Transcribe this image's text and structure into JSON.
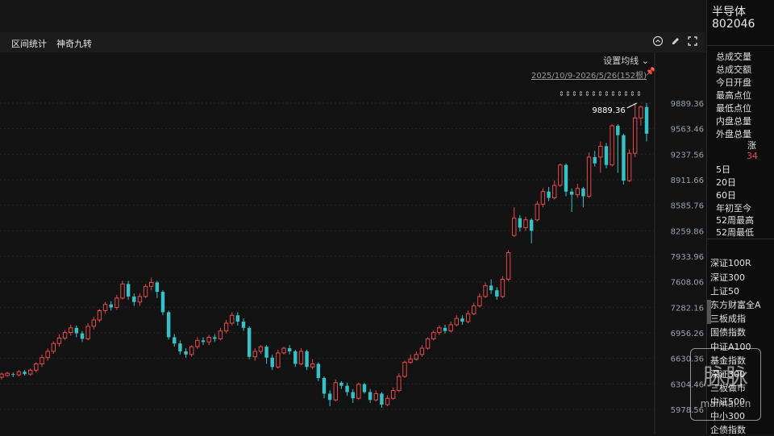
{
  "toolbar": {
    "interval_stats": "区间统计",
    "magic_nine": "神奇九转"
  },
  "chart_header": {
    "ma_setting": "设置均线",
    "range": "2025/10/9-2026/5/26(152根)"
  },
  "security": {
    "name": "半导体",
    "code": "802046"
  },
  "stats_labels": [
    "总成交量",
    "总成交额",
    "今日开盘",
    "最高点位",
    "最低点位",
    "内盘总量",
    "外盘总量"
  ],
  "change": {
    "label": "涨",
    "value": "34"
  },
  "periods": [
    "5日",
    "20日",
    "60日",
    "年初至今",
    "52周最高",
    "52周最低"
  ],
  "indices": [
    "深证100R",
    "深证300",
    "上证50",
    "东方财富全A",
    "三板成指",
    "国债指数",
    "中证A100",
    "基金指数",
    "深证300",
    "三板做市",
    "中证500",
    "中小300",
    "企债指数"
  ],
  "watermark": {
    "text": "脉脉",
    "sub": "maimai.cn"
  },
  "colors": {
    "up": "#e8474b",
    "down": "#35c2c6",
    "axis": "#9aa0a6",
    "grid": "#262626"
  },
  "chart_data": {
    "type": "candlestick",
    "y_ticks": [
      "9889.36",
      "9563.46",
      "9237.56",
      "8911.66",
      "8585.76",
      "8259.86",
      "7933.96",
      "7608.06",
      "7282.16",
      "6956.26",
      "6630.36",
      "6304.46",
      "5978.56"
    ],
    "y_range": [
      5900,
      10010
    ],
    "highest_label": "9889.36",
    "candles": [
      [
        6390,
        6430,
        6360,
        6450
      ],
      [
        6410,
        6440,
        6400,
        6460
      ],
      [
        6430,
        6420,
        6390,
        6450
      ],
      [
        6420,
        6460,
        6400,
        6480
      ],
      [
        6460,
        6430,
        6410,
        6480
      ],
      [
        6430,
        6480,
        6410,
        6500
      ],
      [
        6480,
        6560,
        6450,
        6580
      ],
      [
        6560,
        6640,
        6520,
        6680
      ],
      [
        6640,
        6720,
        6600,
        6760
      ],
      [
        6720,
        6820,
        6690,
        6850
      ],
      [
        6820,
        6890,
        6780,
        6940
      ],
      [
        6890,
        6960,
        6860,
        6990
      ],
      [
        6960,
        7020,
        6920,
        7060
      ],
      [
        7020,
        6950,
        6900,
        7050
      ],
      [
        6950,
        6880,
        6840,
        6980
      ],
      [
        6880,
        7040,
        6860,
        7080
      ],
      [
        7040,
        7120,
        7000,
        7160
      ],
      [
        7120,
        7240,
        7090,
        7260
      ],
      [
        7240,
        7320,
        7200,
        7350
      ],
      [
        7320,
        7280,
        7240,
        7360
      ],
      [
        7280,
        7400,
        7250,
        7440
      ],
      [
        7400,
        7580,
        7380,
        7620
      ],
      [
        7580,
        7420,
        7380,
        7620
      ],
      [
        7420,
        7350,
        7300,
        7460
      ],
      [
        7350,
        7420,
        7300,
        7460
      ],
      [
        7420,
        7550,
        7400,
        7580
      ],
      [
        7550,
        7600,
        7500,
        7660
      ],
      [
        7600,
        7480,
        7400,
        7620
      ],
      [
        7480,
        7220,
        7180,
        7500
      ],
      [
        7220,
        6900,
        6870,
        7240
      ],
      [
        6900,
        6820,
        6780,
        6940
      ],
      [
        6820,
        6720,
        6680,
        6860
      ],
      [
        6720,
        6680,
        6640,
        6760
      ],
      [
        6680,
        6780,
        6650,
        6800
      ],
      [
        6780,
        6860,
        6750,
        6900
      ],
      [
        6860,
        6840,
        6800,
        6900
      ],
      [
        6840,
        6900,
        6800,
        6930
      ],
      [
        6900,
        6880,
        6840,
        6940
      ],
      [
        6880,
        6980,
        6860,
        7020
      ],
      [
        6980,
        7080,
        6950,
        7120
      ],
      [
        7080,
        7180,
        7050,
        7220
      ],
      [
        7180,
        7100,
        7050,
        7220
      ],
      [
        7100,
        7020,
        6980,
        7140
      ],
      [
        7020,
        6650,
        6620,
        7040
      ],
      [
        6650,
        6720,
        6600,
        6760
      ],
      [
        6720,
        6780,
        6690,
        6800
      ],
      [
        6780,
        6640,
        6560,
        6800
      ],
      [
        6640,
        6520,
        6480,
        6680
      ],
      [
        6520,
        6700,
        6500,
        6740
      ],
      [
        6700,
        6760,
        6680,
        6780
      ],
      [
        6760,
        6720,
        6680,
        6800
      ],
      [
        6720,
        6560,
        6520,
        6740
      ],
      [
        6560,
        6720,
        6540,
        6760
      ],
      [
        6720,
        6520,
        6480,
        6740
      ],
      [
        6520,
        6560,
        6490,
        6620
      ],
      [
        6560,
        6380,
        6340,
        6580
      ],
      [
        6380,
        6180,
        6120,
        6400
      ],
      [
        6180,
        6100,
        6020,
        6220
      ],
      [
        6100,
        6320,
        6080,
        6360
      ],
      [
        6320,
        6280,
        6240,
        6340
      ],
      [
        6280,
        6200,
        6150,
        6320
      ],
      [
        6200,
        6120,
        6060,
        6240
      ],
      [
        6120,
        6300,
        6100,
        6320
      ],
      [
        6300,
        6200,
        6180,
        6320
      ],
      [
        6200,
        6100,
        6060,
        6240
      ],
      [
        6100,
        6180,
        6080,
        6220
      ],
      [
        6180,
        6040,
        6000,
        6200
      ],
      [
        6040,
        6120,
        6020,
        6160
      ],
      [
        6120,
        6220,
        6100,
        6260
      ],
      [
        6220,
        6400,
        6200,
        6440
      ],
      [
        6400,
        6580,
        6380,
        6600
      ],
      [
        6580,
        6620,
        6560,
        6680
      ],
      [
        6620,
        6680,
        6600,
        6720
      ],
      [
        6680,
        6760,
        6650,
        6800
      ],
      [
        6760,
        6880,
        6740,
        6900
      ],
      [
        6880,
        6960,
        6860,
        6990
      ],
      [
        6960,
        7020,
        6930,
        7050
      ],
      [
        7020,
        6980,
        6950,
        7060
      ],
      [
        6980,
        7060,
        6960,
        7100
      ],
      [
        7060,
        7140,
        7040,
        7180
      ],
      [
        7140,
        7100,
        7060,
        7180
      ],
      [
        7100,
        7200,
        7080,
        7240
      ],
      [
        7200,
        7300,
        7180,
        7340
      ],
      [
        7300,
        7420,
        7280,
        7460
      ],
      [
        7420,
        7560,
        7400,
        7600
      ],
      [
        7560,
        7500,
        7450,
        7640
      ],
      [
        7500,
        7420,
        7380,
        7540
      ],
      [
        7420,
        7640,
        7400,
        7680
      ],
      [
        7640,
        7980,
        7620,
        8010
      ],
      [
        8200,
        8420,
        8180,
        8560
      ],
      [
        8420,
        8300,
        8250,
        8460
      ],
      [
        8300,
        8400,
        8260,
        8440
      ],
      [
        8400,
        8260,
        8100,
        8420
      ],
      [
        8400,
        8600,
        8380,
        8640
      ],
      [
        8600,
        8760,
        8560,
        8800
      ],
      [
        8760,
        8680,
        8640,
        8820
      ],
      [
        8680,
        8840,
        8660,
        8900
      ],
      [
        8840,
        9100,
        8820,
        9120
      ],
      [
        9100,
        8760,
        8700,
        9120
      ],
      [
        8760,
        8720,
        8500,
        8800
      ],
      [
        8720,
        8800,
        8680,
        8860
      ],
      [
        8800,
        8700,
        8560,
        8820
      ],
      [
        8700,
        9200,
        8680,
        9260
      ],
      [
        9200,
        9120,
        9080,
        9280
      ],
      [
        9200,
        9340,
        9000,
        9400
      ],
      [
        9340,
        9100,
        9060,
        9380
      ],
      [
        9100,
        9600,
        9080,
        9620
      ],
      [
        9600,
        9480,
        9000,
        9620
      ],
      [
        9480,
        8900,
        8850,
        9500
      ],
      [
        8900,
        9250,
        8880,
        9300
      ],
      [
        9250,
        9700,
        9200,
        9880
      ],
      [
        9700,
        9840,
        9600,
        9860
      ],
      [
        9840,
        9500,
        9400,
        9889
      ]
    ]
  }
}
